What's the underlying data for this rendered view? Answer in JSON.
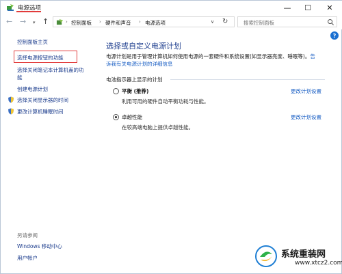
{
  "window": {
    "title": "电源选项",
    "controls": {
      "minimize": "—",
      "maximize": "☐",
      "close": "✕"
    }
  },
  "address": {
    "breadcrumbs": [
      "控制面板",
      "硬件和声音",
      "电源选项"
    ],
    "search_placeholder": "搜索控制面板"
  },
  "sidebar": {
    "home": "控制面板主页",
    "items": [
      "选择电源按钮的功能",
      "选择关闭笔记本计算机盖的功",
      "能",
      "创建电源计划",
      "选择关闭显示器的时间",
      "更改计算机睡眠时间"
    ],
    "see_also_label": "另请参阅",
    "see_also": [
      "Windows 移动中心",
      "用户帐户"
    ]
  },
  "main": {
    "title": "选择或自定义电源计划",
    "description": "电源计划是用于管理计算机如何使用电源的一套硬件和系统设置(如显示器亮度、睡眠等)。",
    "description_link_a": "告",
    "description_link_b": "诉我有关电源计划的详细信息",
    "section_label": "电池指示器上显示的计划",
    "plans": [
      {
        "name": "平衡 (推荐)",
        "description": "利用可用的硬件自动平衡功耗与性能。",
        "change_link": "更改计划设置",
        "selected": false
      },
      {
        "name": "卓越性能",
        "description": "在较高端电脑上提供卓越性能。",
        "change_link": "更改计划设置",
        "selected": true
      }
    ]
  },
  "watermark": {
    "title": "系统重装网",
    "url": "www.xtcz2.com"
  },
  "colors": {
    "link": "#1a5fc4",
    "title_blue": "#1f3f8f",
    "highlight_red": "#e23b3b",
    "help_blue": "#1a6fd1"
  }
}
